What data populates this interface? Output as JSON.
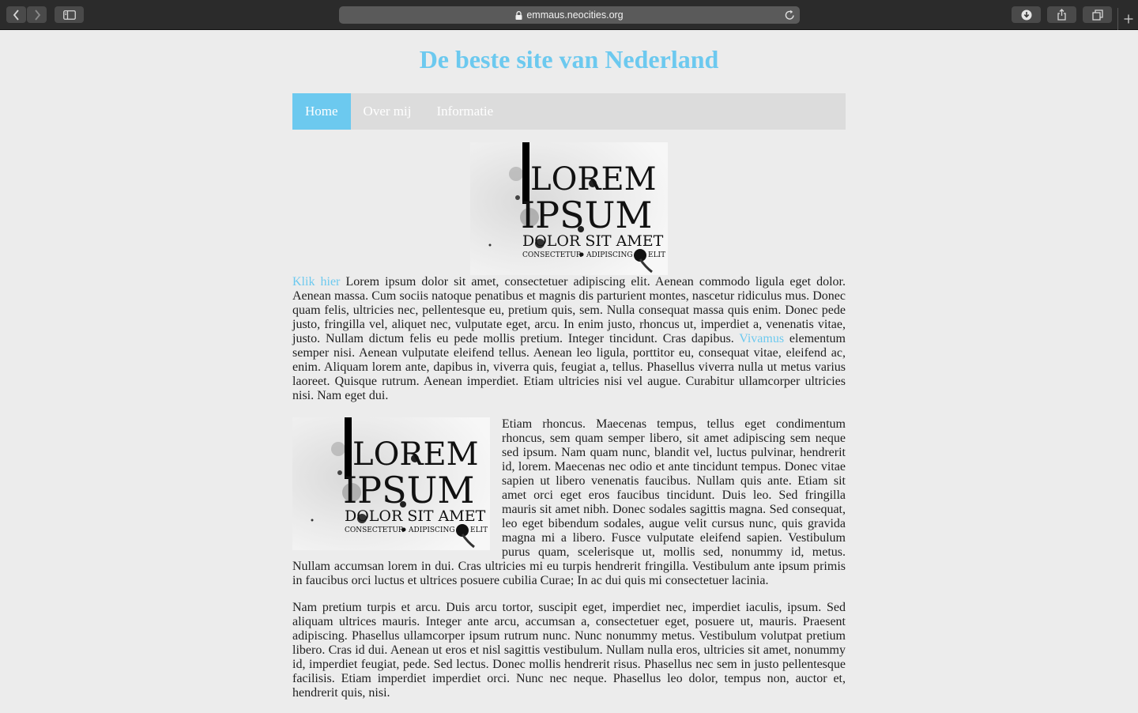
{
  "browser": {
    "url": "emmaus.neocities.org",
    "icons": [
      "back-icon",
      "forward-icon",
      "sidebar-icon",
      "lock-icon",
      "reload-icon",
      "download-icon",
      "share-icon",
      "tabs-icon",
      "new-tab-icon"
    ]
  },
  "site": {
    "title": "De beste site van Nederland",
    "accent_color": "#6cc9ef",
    "nav": [
      {
        "label": "Home",
        "active": true
      },
      {
        "label": "Over mij",
        "active": false
      },
      {
        "label": "Informatie",
        "active": false
      }
    ]
  },
  "logo": {
    "line1": "LOREM",
    "line2": "IPSUM",
    "line3": "DOLOR SIT AMET",
    "line4_a": "CONSECTETUR",
    "line4_b": "ADIPISCING",
    "line4_c": "ELIT"
  },
  "content": {
    "p1_link": "Klik hier",
    "p1_a": " Lorem ipsum dolor sit amet, consectetuer adipiscing elit. Aenean commodo ligula eget dolor. Aenean massa. Cum sociis natoque penatibus et magnis dis parturient montes, nascetur ridiculus mus. Donec quam felis, ultricies nec, pellentesque eu, pretium quis, sem. Nulla consequat massa quis enim. Donec pede justo, fringilla vel, aliquet nec, vulputate eget, arcu. In enim justo, rhoncus ut, imperdiet a, venenatis vitae, justo. Nullam dictum felis eu pede mollis pretium. Integer tincidunt. Cras dapibus. ",
    "p1_link2": "Vivamus",
    "p1_b": " elementum semper nisi. Aenean vulputate eleifend tellus. Aenean leo ligula, porttitor eu, consequat vitae, eleifend ac, enim. Aliquam lorem ante, dapibus in, viverra quis, feugiat a, tellus. Phasellus viverra nulla ut metus varius laoreet. Quisque rutrum. Aenean imperdiet. Etiam ultricies nisi vel augue. Curabitur ullamcorper ultricies nisi. Nam eget dui.",
    "p2": "Etiam rhoncus. Maecenas tempus, tellus eget condimentum rhoncus, sem quam semper libero, sit amet adipiscing sem neque sed ipsum. Nam quam nunc, blandit vel, luctus pulvinar, hendrerit id, lorem. Maecenas nec odio et ante tincidunt tempus. Donec vitae sapien ut libero venenatis faucibus. Nullam quis ante. Etiam sit amet orci eget eros faucibus tincidunt. Duis leo. Sed fringilla mauris sit amet nibh. Donec sodales sagittis magna. Sed consequat, leo eget bibendum sodales, augue velit cursus nunc, quis gravida magna mi a libero. Fusce vulputate eleifend sapien. Vestibulum purus quam, scelerisque ut, mollis sed, nonummy id, metus. Nullam accumsan lorem in dui. Cras ultricies mi eu turpis hendrerit fringilla. Vestibulum ante ipsum primis in faucibus orci luctus et ultrices posuere cubilia Curae; In ac dui quis mi consectetuer lacinia.",
    "p3": "Nam pretium turpis et arcu. Duis arcu tortor, suscipit eget, imperdiet nec, imperdiet iaculis, ipsum. Sed aliquam ultrices mauris. Integer ante arcu, accumsan a, consectetuer eget, posuere ut, mauris. Praesent adipiscing. Phasellus ullamcorper ipsum rutrum nunc. Nunc nonummy metus. Vestibulum volutpat pretium libero. Cras id dui. Aenean ut eros et nisl sagittis vestibulum. Nullam nulla eros, ultricies sit amet, nonummy id, imperdiet feugiat, pede. Sed lectus. Donec mollis hendrerit risus. Phasellus nec sem in justo pellentesque facilisis. Etiam imperdiet imperdiet orci. Nunc nec neque. Phasellus leo dolor, tempus non, auctor et, hendrerit quis, nisi."
  }
}
